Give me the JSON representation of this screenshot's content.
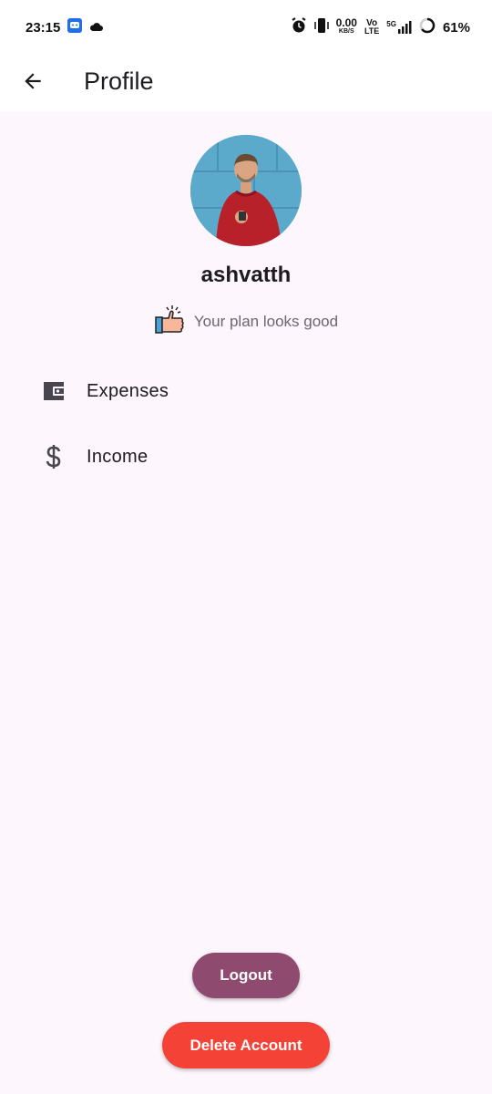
{
  "status_bar": {
    "time": "23:15",
    "net_speed_value": "0.00",
    "net_speed_unit": "KB/S",
    "volte_top": "Vo",
    "volte_bottom": "LTE",
    "network": "5G",
    "battery": "61%",
    "icons": [
      "messaging-app-icon",
      "cloud-icon",
      "alarm-icon",
      "vibrate-icon",
      "signal-icon",
      "battery-ring-icon"
    ]
  },
  "app_bar": {
    "title": "Profile",
    "back_icon": "arrow-left-icon"
  },
  "profile": {
    "username": "ashvatth",
    "plan_message": "Your plan looks good",
    "plan_icon": "thumbs-up-icon",
    "avatar": "avatar"
  },
  "menu": {
    "items": [
      {
        "label": "Expenses",
        "icon": "wallet-icon"
      },
      {
        "label": "Income",
        "icon": "dollar-icon"
      }
    ]
  },
  "actions": {
    "logout_label": "Logout",
    "delete_label": "Delete Account"
  },
  "colors": {
    "background": "#fdf6fd",
    "logout": "#8e4b6f",
    "delete": "#f44336",
    "text_primary": "#1d1b20",
    "text_secondary": "#6b6670"
  }
}
